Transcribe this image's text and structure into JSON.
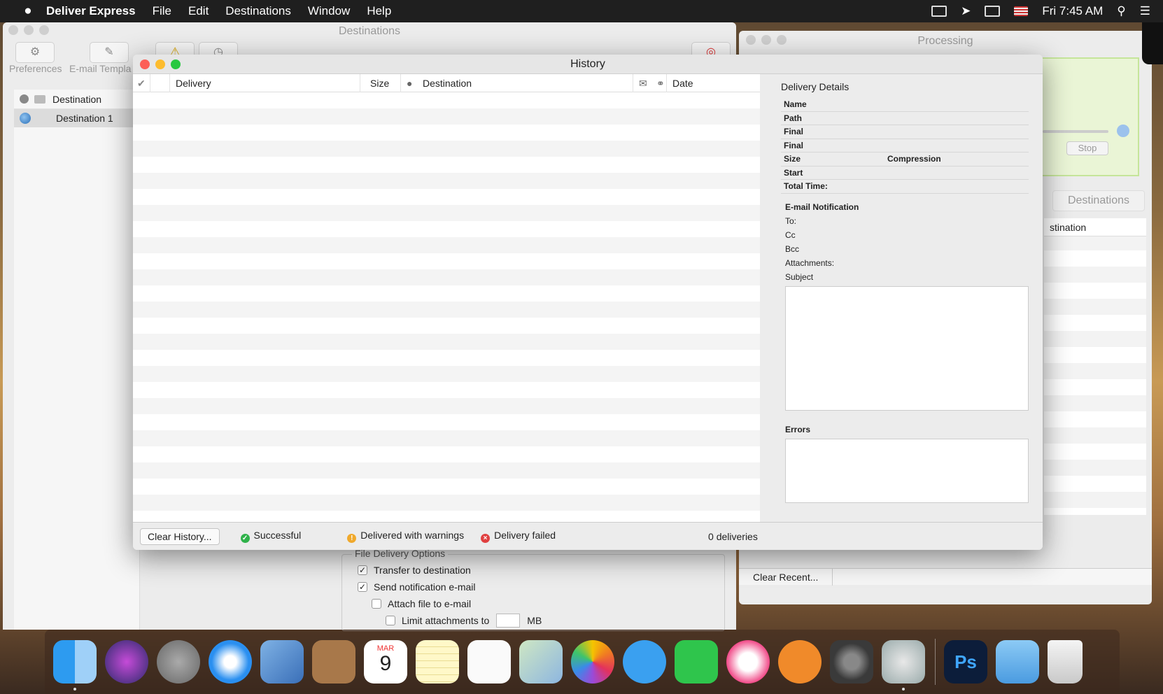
{
  "menubar": {
    "app_name": "Deliver Express",
    "menus": [
      "File",
      "Edit",
      "Destinations",
      "Window",
      "Help"
    ],
    "clock": "Fri 7:45 AM"
  },
  "destinations_window": {
    "title": "Destinations",
    "toolbar": {
      "preferences": "Preferences",
      "email_templates": "E-mail Templa"
    },
    "sidebar": {
      "header": "Destination",
      "item": "Destination 1"
    },
    "file_delivery_options": {
      "legend": "File Delivery Options",
      "transfer": "Transfer to destination",
      "notify": "Send notification e-mail",
      "attach": "Attach file to e-mail",
      "limit": "Limit attachments to",
      "unit": "MB"
    }
  },
  "processing_window": {
    "title": "Processing",
    "stop": "Stop",
    "destinations_tab": "Destinations",
    "list_header": "stination",
    "clear_recent": "Clear Recent..."
  },
  "history_window": {
    "title": "History",
    "columns": {
      "delivery": "Delivery",
      "size": "Size",
      "destination": "Destination",
      "date": "Date"
    },
    "details": {
      "heading": "Delivery Details",
      "fields": [
        "Name",
        "Path",
        "Final",
        "Final",
        "Size",
        "Start",
        "Total Time:"
      ],
      "compression": "Compression",
      "email_heading": "E-mail Notification",
      "email_fields": [
        "To:",
        "Cc",
        "Bcc",
        "Attachments:",
        "Subject"
      ],
      "errors_heading": "Errors"
    },
    "footer": {
      "clear_history": "Clear History...",
      "successful": "Successful",
      "warnings": "Delivered with warnings",
      "failed": "Delivery failed",
      "count": "0 deliveries"
    }
  },
  "dock": {
    "calendar_month": "MAR",
    "calendar_day": "9",
    "photoshop": "Ps"
  }
}
